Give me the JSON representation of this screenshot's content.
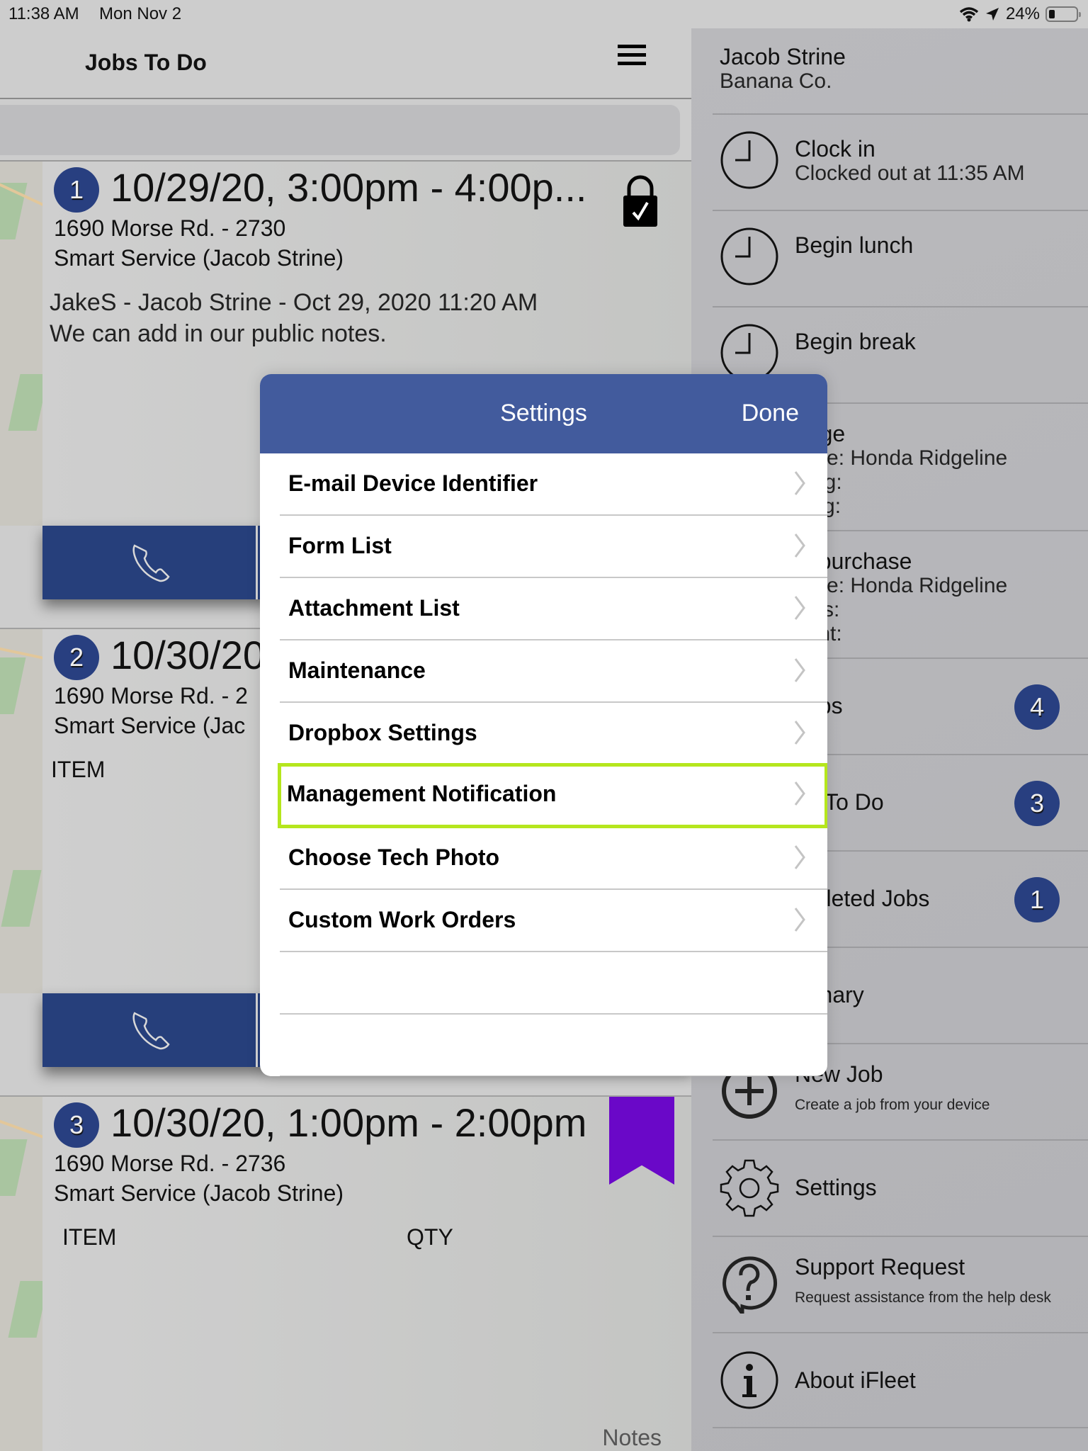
{
  "status_bar": {
    "time": "11:38 AM",
    "date": "Mon Nov 2",
    "battery": "24%",
    "battery_level": 0.24,
    "icons": [
      "wifi-icon",
      "location-arrow-icon",
      "battery-icon"
    ]
  },
  "main": {
    "title": "Jobs To Do",
    "menu_icon": "hamburger-icon",
    "jobs": [
      {
        "number": "1",
        "title": "10/29/20, 3:00pm - 4:00p...",
        "address": "1690 Morse Rd. - 2730",
        "technician": "Smart Service (Jacob Strine)",
        "note_header": "JakeS - Jacob Strine - Oct 29, 2020 11:20 AM",
        "note_body": "We can add in our public notes.",
        "status_icon": "lock-check-icon",
        "action_icon": "phone-icon"
      },
      {
        "number": "2",
        "title": "10/30/20",
        "address": "1690 Morse Rd. - 2",
        "technician": "Smart Service (Jac",
        "item_header": "ITEM",
        "action_icon": "phone-icon"
      },
      {
        "number": "3",
        "title": "10/30/20, 1:00pm - 2:00pm",
        "address": "1690 Morse Rd. - 2736",
        "technician": "Smart Service (Jacob Strine)",
        "item_header": "ITEM",
        "qty_header": "QTY",
        "notes_label": "Notes",
        "status_icon": "bookmark-icon",
        "bookmark_color": "#6a08c8"
      }
    ]
  },
  "sidebar": {
    "user_name": "Jacob Strine",
    "company": "Banana Co.",
    "items": [
      {
        "label": "Clock in",
        "sub": "Clocked out at 11:35 AM",
        "icon": "clock-icon"
      },
      {
        "label": "Begin lunch",
        "icon": "clock-icon"
      },
      {
        "label": "Begin break",
        "icon": "clock-icon"
      },
      {
        "label": "eage",
        "lines": [
          "nicle: Honda Ridgeline",
          "rting:",
          "ding:"
        ]
      },
      {
        "label": "el purchase",
        "lines": [
          "nicle: Honda Ridgeline",
          "lons:",
          "ount:"
        ]
      },
      {
        "label": "Jobs",
        "count": "4"
      },
      {
        "label": "bs To Do",
        "count": "3"
      },
      {
        "label": "mpleted Jobs",
        "count": "1"
      },
      {
        "label": "mmary"
      },
      {
        "label": "New Job",
        "sub": "Create a job from your device",
        "icon": "plus-circle-icon"
      },
      {
        "label": "Settings",
        "icon": "gear-icon"
      },
      {
        "label": "Support Request",
        "sub": "Request assistance from the help desk",
        "icon": "question-bubble-icon"
      },
      {
        "label": "About iFleet",
        "icon": "info-icon"
      }
    ]
  },
  "modal": {
    "title": "Settings",
    "done_label": "Done",
    "header_color": "#425b9d",
    "highlight_color": "#b5e61d",
    "highlighted_item": "Management Notification",
    "items": [
      "E-mail Device Identifier",
      "Form List",
      "Attachment List",
      "Maintenance",
      "Dropbox Settings",
      "Management Notification",
      "Choose Tech Photo",
      "Custom Work Orders",
      "",
      ""
    ]
  }
}
